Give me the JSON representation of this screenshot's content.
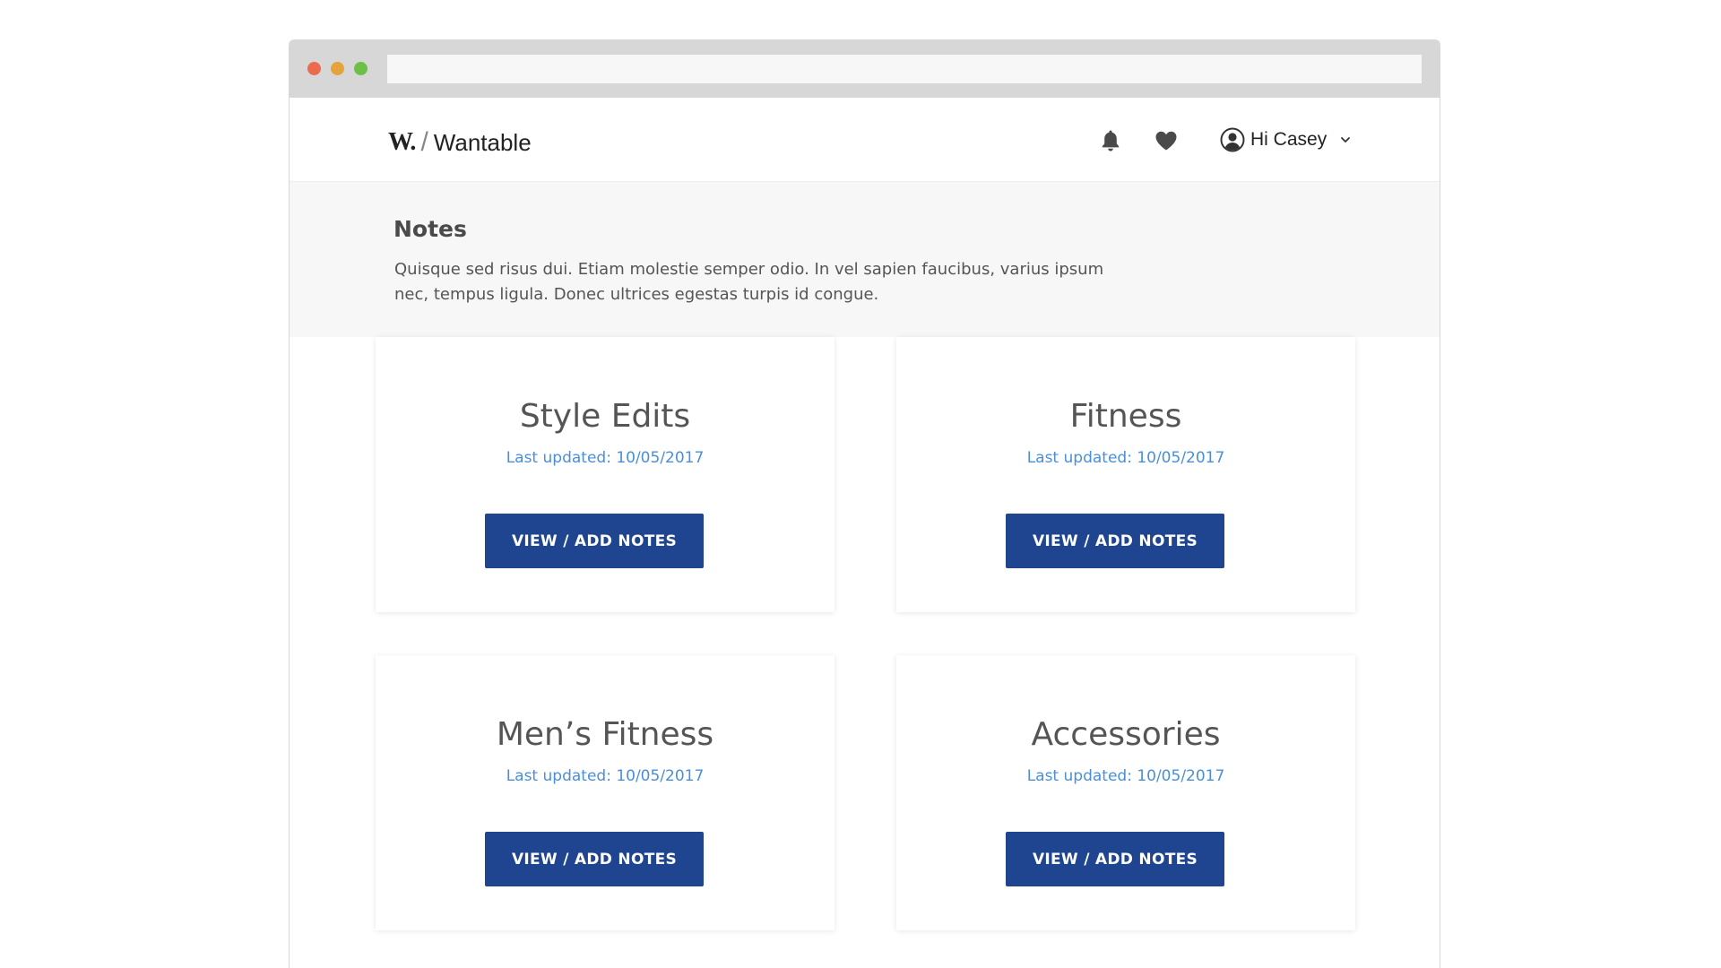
{
  "browser": {
    "address_bar_value": ""
  },
  "header": {
    "logo_mark": "W.",
    "logo_slash": "/",
    "logo_text": "Wantable",
    "bell_icon": "bell-icon",
    "heart_icon": "heart-icon",
    "user_greeting": "Hi Casey"
  },
  "intro": {
    "title": "Notes",
    "description": "Quisque sed risus dui. Etiam molestie semper odio. In vel sapien faucibus, varius ipsum nec, tempus ligula. Donec ultrices egestas turpis id congue."
  },
  "cards": [
    {
      "title": "Style Edits",
      "updated": "Last updated: 10/05/2017",
      "button_label": "VIEW / ADD NOTES"
    },
    {
      "title": "Fitness",
      "updated": "Last updated: 10/05/2017",
      "button_label": "VIEW / ADD NOTES"
    },
    {
      "title": "Men’s Fitness",
      "updated": "Last updated: 10/05/2017",
      "button_label": "VIEW / ADD NOTES"
    },
    {
      "title": "Accessories",
      "updated": "Last updated: 10/05/2017",
      "button_label": "VIEW / ADD NOTES"
    }
  ],
  "colors": {
    "accent_button": "#1f4590",
    "link_blue": "#4a8fd9",
    "intro_bg": "#f7f7f7",
    "chrome_bg": "#d7d7d7"
  }
}
